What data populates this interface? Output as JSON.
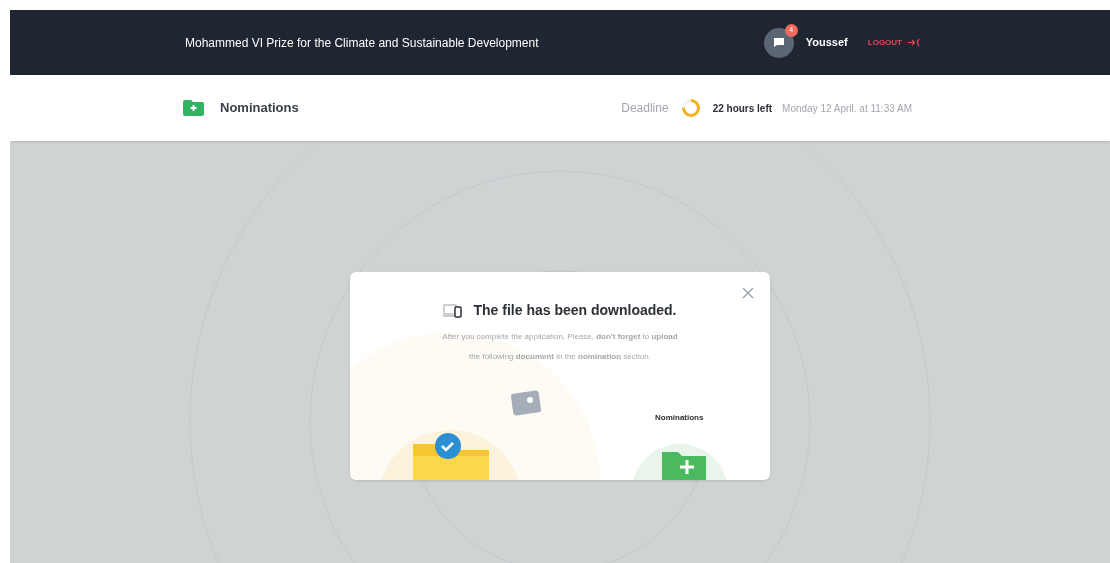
{
  "header": {
    "title": "Mohammed VI Prize for the Climate and Sustainable Development",
    "notification_count": "4",
    "user": "Youssef",
    "logout": "LOGOUT"
  },
  "subheader": {
    "title": "Nominations",
    "deadline_label": "Deadline",
    "deadline": {
      "level": 0.75
    },
    "time_left": "22 hours left",
    "date": "Monday 12 April. at 11:33 AM"
  },
  "modal": {
    "title": "The file has been downloaded.",
    "message": "After you complete the application, Please, **don't forget** to **upload**",
    "message_2": "the following **document** in the **nomination** section.",
    "target_label": "Nominations"
  }
}
